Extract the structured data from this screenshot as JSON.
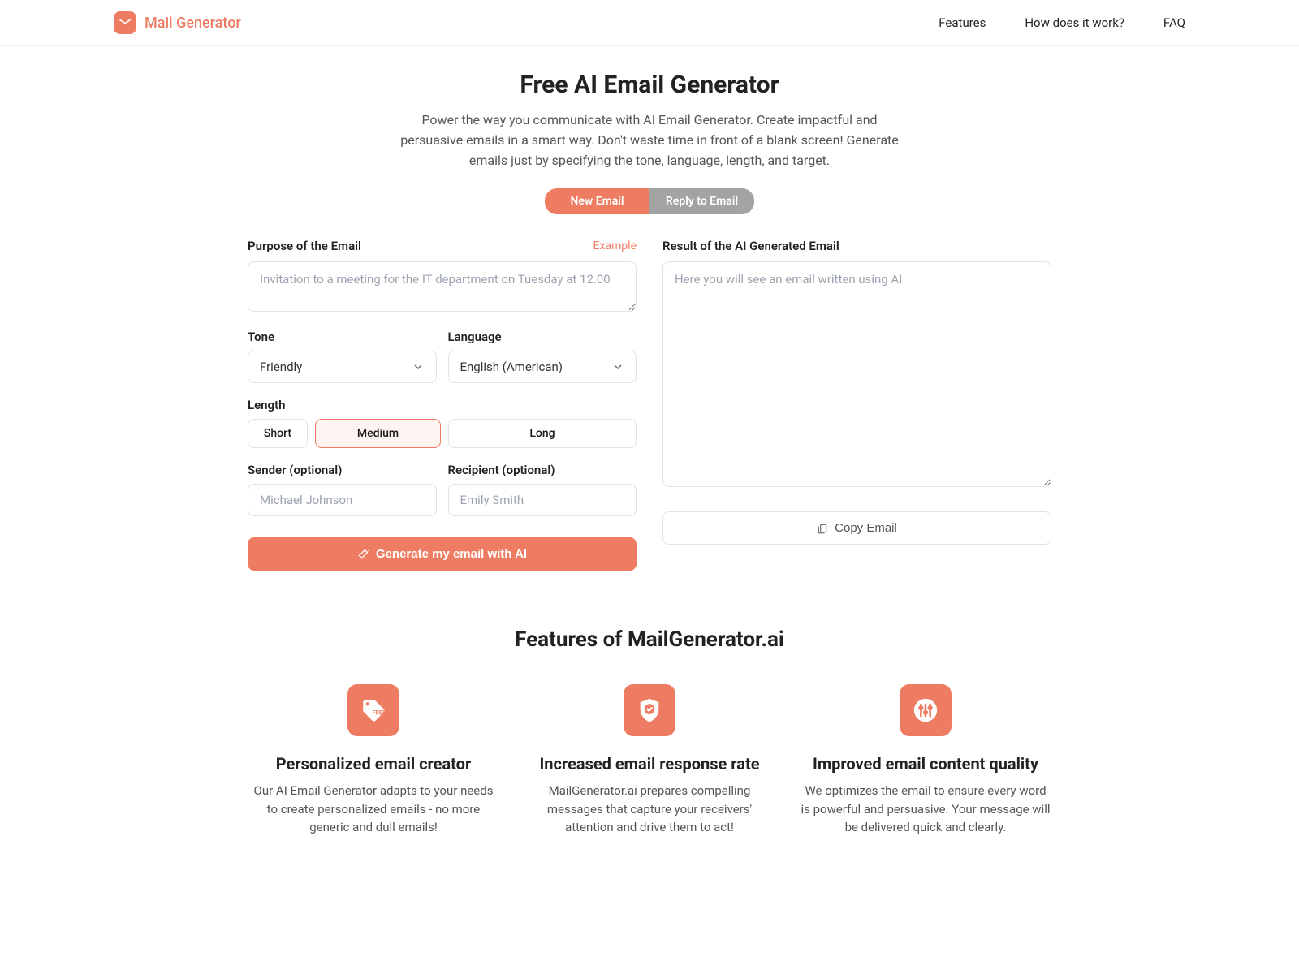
{
  "brand": "Mail Generator",
  "nav": {
    "features": "Features",
    "how": "How does it work?",
    "faq": "FAQ"
  },
  "hero": {
    "title": "Free AI Email Generator",
    "subtitle": "Power the way you communicate with AI Email Generator. Create impactful and persuasive emails in a smart way. Don't waste time in front of a blank screen! Generate emails just by specifying the tone, language, length, and target."
  },
  "tabs": {
    "new": "New Email",
    "reply": "Reply to Email"
  },
  "form": {
    "purpose_label": "Purpose of the Email",
    "example": "Example",
    "purpose_placeholder": "Invitation to a meeting for the IT department on Tuesday at 12.00",
    "tone_label": "Tone",
    "tone_value": "Friendly",
    "language_label": "Language",
    "language_value": "English (American)",
    "length_label": "Length",
    "length": {
      "short": "Short",
      "medium": "Medium",
      "long": "Long"
    },
    "sender_label": "Sender (optional)",
    "sender_placeholder": "Michael Johnson",
    "recipient_label": "Recipient (optional)",
    "recipient_placeholder": "Emily Smith",
    "generate": "Generate my email with AI"
  },
  "result": {
    "label": "Result of the AI Generated Email",
    "placeholder": "Here you will see an email written using AI",
    "copy": "Copy Email"
  },
  "features_section": {
    "title": "Features of MailGenerator.ai",
    "items": [
      {
        "title": "Personalized email creator",
        "desc": "Our AI Email Generator adapts to your needs to create personalized emails - no more generic and dull emails!"
      },
      {
        "title": "Increased email response rate",
        "desc": "MailGenerator.ai prepares compelling messages that capture your receivers' attention and drive them to act!"
      },
      {
        "title": "Improved email content quality",
        "desc": "We optimizes the email to ensure every word is powerful and persuasive. Your message will be delivered quick and clearly."
      }
    ]
  }
}
